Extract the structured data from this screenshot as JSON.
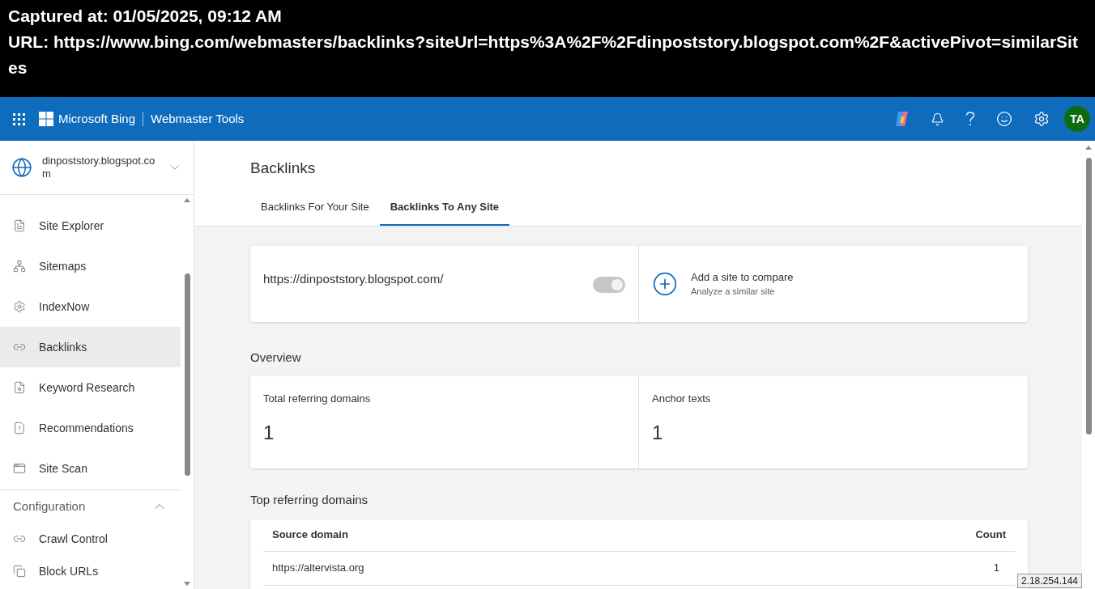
{
  "capture": {
    "captured_at": "Captured at: 01/05/2025, 09:12 AM",
    "url": "URL: https://www.bing.com/webmasters/backlinks?siteUrl=https%3A%2F%2Fdinpoststory.blogspot.com%2F&activePivot=similarSites"
  },
  "topbar": {
    "brand": "Microsoft Bing",
    "product": "Webmaster Tools",
    "avatar": "TA"
  },
  "sidebar": {
    "site": "dinpoststory.blogspot.com",
    "items": [
      {
        "label": "Site Explorer",
        "selected": false
      },
      {
        "label": "Sitemaps",
        "selected": false
      },
      {
        "label": "IndexNow",
        "selected": false
      },
      {
        "label": "Backlinks",
        "selected": true
      },
      {
        "label": "Keyword Research",
        "selected": false
      },
      {
        "label": "Recommendations",
        "selected": false
      },
      {
        "label": "Site Scan",
        "selected": false
      }
    ],
    "section": {
      "title": "Configuration",
      "expanded": true,
      "items": [
        {
          "label": "Crawl Control",
          "selected": false
        },
        {
          "label": "Block URLs",
          "selected": false
        }
      ]
    }
  },
  "page": {
    "title": "Backlinks",
    "tabs": [
      {
        "label": "Backlinks For Your Site",
        "selected": false
      },
      {
        "label": "Backlinks To Any Site",
        "selected": true
      }
    ],
    "site_card": {
      "url": "https://dinpoststory.blogspot.com/",
      "on": true,
      "disabled": true,
      "add_title": "Add a site to compare",
      "add_subtitle": "Analyze a similar site"
    },
    "overview": {
      "title": "Overview",
      "stats": [
        {
          "label": "Total referring domains",
          "value": "1"
        },
        {
          "label": "Anchor texts",
          "value": "1"
        }
      ]
    },
    "top_domains": {
      "title": "Top referring domains",
      "columns": [
        "Source domain",
        "Count"
      ],
      "rows": [
        [
          "https://altervista.org",
          "1"
        ]
      ]
    }
  },
  "ip_tooltip": "2.18.254.144"
}
